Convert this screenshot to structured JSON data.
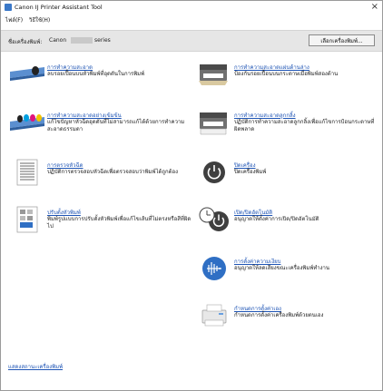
{
  "window": {
    "title": "Canon IJ Printer Assistant Tool",
    "close_icon": "×"
  },
  "menu": {
    "items": [
      "ไฟล์(F)",
      "วิธีใช้(H)"
    ]
  },
  "printer": {
    "label": "ชื่อเครื่องพิมพ์:",
    "name": "Canon",
    "series": "series",
    "change_button": "เลือกเครื่องพิมพ์..."
  },
  "left_items": [
    {
      "icon": "print-head-cleaning-icon",
      "link": "การทำความสะอาด",
      "desc": "ลบรอยเปื้อนบนหัวพิมพ์ที่อุดตันในการพิมพ์"
    },
    {
      "icon": "deep-cleaning-icon",
      "link": "การทำความสะอาดอย่างเข้มข้น",
      "desc": "แก้ไขปัญหาหัวฉีดอุดตันที่ไม่สามารถแก้ได้ด้วยการทำความสะอาดธรรมดา"
    },
    {
      "icon": "nozzle-check-icon",
      "link": "การตรวจหัวฉีด",
      "desc": "ปฏิบัติการตรวจสอบหัวฉีดเพื่อตรวจสอบว่าพิมพ์ได้ถูกต้อง"
    },
    {
      "icon": "print-head-alignment-icon",
      "link": "ปรับตั้งหัวพิมพ์",
      "desc": "พิมพ์รูปแบบการปรับตั้งหัวพิมพ์เพื่อแก้ไขเส้นที่ไม่ตรงหรือสีที่ผิดไป"
    }
  ],
  "right_items": [
    {
      "icon": "bottom-plate-cleaning-icon",
      "link": "การทำความสะอาดแผ่นด้านล่าง",
      "desc": "ป้องกันรอยเปื้อนบนกระดาษเมื่อพิมพ์สองด้าน"
    },
    {
      "icon": "roller-cleaning-icon",
      "link": "การทำความสะอาดลูกกลิ้ง",
      "desc": "ปฏิบัติการทำความสะอาดลูกกลิ้งเพื่อแก้ไขการป้อนกระดาษที่ผิดพลาด"
    },
    {
      "icon": "power-off-icon",
      "link": "ปิดเครื่อง",
      "desc": "ปิดเครื่องพิมพ์"
    },
    {
      "icon": "auto-power-icon",
      "link": "เปิด/ปิดอัตโนมัติ",
      "desc": "อนุญาตให้ตั้งค่าการเปิด/ปิดอัตโนมัติ"
    },
    {
      "icon": "quiet-setting-icon",
      "link": "การตั้งค่าความเงียบ",
      "desc": "อนุญาตให้ลดเสียงขณะเครื่องพิมพ์ทำงาน"
    },
    {
      "icon": "custom-settings-icon",
      "link": "กำหนดการตั้งค่าเอง",
      "desc": "กำหนดการตั้งค่าเครื่องพิมพ์ด้วยตนเอง"
    }
  ],
  "footer": {
    "link": "แสดงสถานะเครื่องพิมพ์"
  }
}
